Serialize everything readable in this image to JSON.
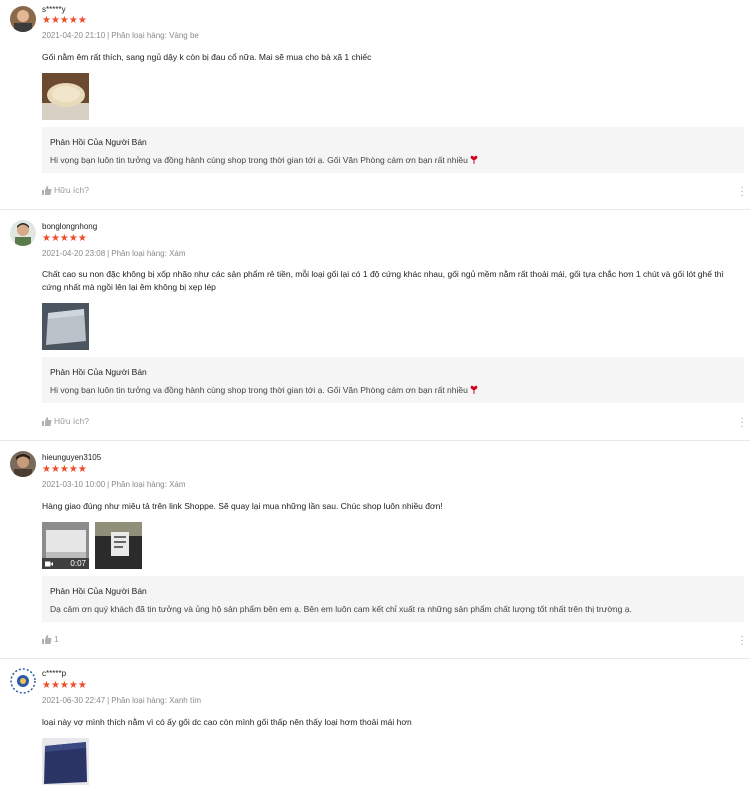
{
  "reviews": [
    {
      "username": "s*****y",
      "stars": "★★★★★",
      "datetime": "2021-04-20 21:10",
      "separator": "|",
      "variation": "Phân loại hàng: Vàng be",
      "comment": "Gối nằm êm rất thích, sang ngủ dậy k còn bị đau cổ nữa. Mai sẽ mua cho bà xã 1 chiếc",
      "reply_title": "Phản Hồi Của Người Bán",
      "reply_body": "Hi vọng bạn luôn tin tưởng va đồng hành cùng shop trong thời gian tới ạ. Gối Văn Phòng cám ơn bạn rất nhiều",
      "helpful_label": "Hữu ích?"
    },
    {
      "username": "bonglongnhong",
      "stars": "★★★★★",
      "datetime": "2021-04-20 23:08",
      "separator": "|",
      "variation": "Phân loại hàng: Xám",
      "comment": "Chất cao su non đặc không bị xốp nhão như các sản phẩm rẻ tiền, mỗi loại gối lại có 1 độ cứng khác nhau, gối ngủ mềm nằm rất thoải mái, gối tựa chắc hơn 1 chút và gối lót ghế thì cứng nhất mà ngồi lên lại êm không bị xẹp lép",
      "reply_title": "Phản Hồi Của Người Bán",
      "reply_body": "Hi vọng bạn luôn tin tưởng va đồng hành cùng shop trong thời gian tới ạ. Gối Văn Phòng cám ơn bạn rất nhiều",
      "helpful_label": "Hữu ích?"
    },
    {
      "username": "hieunguyen3105",
      "stars": "★★★★★",
      "datetime": "2021-03-10 10:00",
      "separator": "|",
      "variation": "Phân loại hàng: Xám",
      "comment": "Hàng giao đúng như miêu tả trên link Shoppe. Sẽ quay lại mua những lần sau. Chúc shop luôn nhiều đơn!",
      "video_duration": "0:07",
      "reply_title": "Phản Hồi Của Người Bán",
      "reply_body": "Dạ cảm ơn quý khách đã tin tưởng và ủng hộ sản phẩm bên em ạ. Bên em luôn cam kết chỉ xuất ra những sản phẩm chất lượng tốt nhất trên thị trường ạ.",
      "helpful_count": "1"
    },
    {
      "username": "c*****p",
      "stars": "★★★★★",
      "datetime": "2021-06-30 22:47",
      "separator": "|",
      "variation": "Phân loại hàng: Xanh tím",
      "comment": "loại này vợ mình thích nằm vì có ấy gối dc cao còn mình gối thấp nên thấy loại hơm thoải mái hơn"
    }
  ],
  "colors": {
    "star": "#ee4d2d",
    "reply_bg": "#f5f5f5",
    "heart": "#d0011b"
  }
}
